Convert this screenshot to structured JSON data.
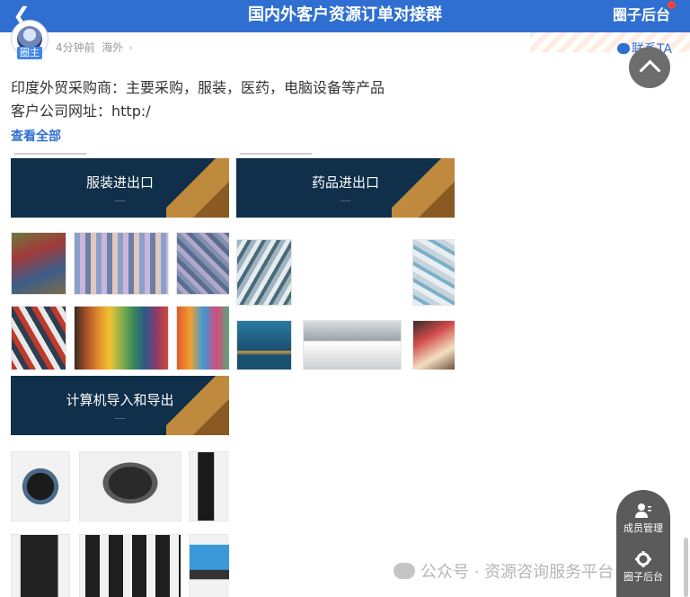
{
  "header": {
    "title": "国内外客户资源订单对接群",
    "admin_label": "圈子后台",
    "back_icon": "chevron-left-icon"
  },
  "post": {
    "owner_badge": "圈主",
    "time": "4分钟前",
    "region": "海外",
    "contact_label": "联系TA",
    "line1": "印度外贸采购商：主要采购，服装，医药，电脑设备等产品",
    "line2": "客户公司网址：http:/",
    "see_all": "查看全部"
  },
  "images": [
    {
      "title": "服装进出口"
    },
    {
      "title": "药品进出口"
    },
    {
      "title": "计算机导入和导出"
    }
  ],
  "dock": {
    "members_label": "成员管理",
    "admin_label": "圈子后台"
  },
  "watermark": "公众号 · 资源咨询服务平台",
  "colors": {
    "accent": "#2f6fd1",
    "dark_banner": "#0f2f4a",
    "dock": "#5b5b5b"
  }
}
